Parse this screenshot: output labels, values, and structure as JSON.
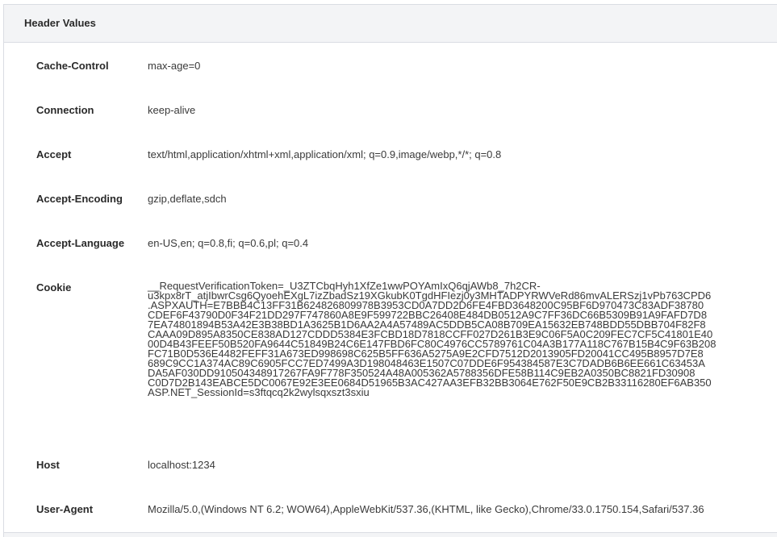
{
  "panel": {
    "title": "Header Values"
  },
  "headers": [
    {
      "name": "Cache-Control",
      "value": "max-age=0"
    },
    {
      "name": "Connection",
      "value": "keep-alive"
    },
    {
      "name": "Accept",
      "value": "text/html,application/xhtml+xml,application/xml; q=0.9,image/webp,*/*; q=0.8"
    },
    {
      "name": "Accept-Encoding",
      "value": "gzip,deflate,sdch"
    },
    {
      "name": "Accept-Language",
      "value": "en-US,en; q=0.8,fi; q=0.6,pl; q=0.4"
    },
    {
      "name": "Cookie",
      "lines": [
        "__RequestVerificationToken=_U3ZTCbqHyh1XfZe1wwPOYAmIxQ6qjAWb8_7h2CR-",
        "u3kpx8rT_atjIbwrCsg6QyoehEXgL7izZbadSz19XGkubK0TgdHFIezj0y3MHTADPYRWVeRd86mvALERSzj1vPb763CPD6",
        ".ASPXAUTH=E7BBB4C13FF31B624826809978B3953CD0A7DD2D6FE4FBD3648200C95BF6D970473C83ADF38780",
        "CDEF6F43790D0F34F21DD297F747860A8E9F599722BBC26408E484DB0512A9C7FF36DC66B5309B91A9FAFD7D8",
        "7EA74801894B53A42E3B38BD1A3625B1D6AA2A4A57489AC5DDB5CA08B709EA15632EB748BDD55DBB704F82F8",
        "CAAA09D895A8350CE838AD127CDDD5384E3FCBD18D7818CCFF027D261B3E9C06F5A0C209FEC7CF5C41801E40",
        "00D4B43FEEF50B520FA9644C51849B24C6E147FBD6FC80C4976CC5789761C04A3B177A118C767B15B4C9F63B208",
        "FC71B0D536E4482FEFF31A673ED998698C625B5FF636A5275A9E2CFD7512D2013905FD20041CC495B8957D7E8",
        "689C9CC1A374AC89C6905FCC7ED7499A3D198048463E1507C07DDE6F954384587E3C7DADB6B6EE661C63453A",
        "DA5AF030DD910504348917267FA9F778F350524A48A005362A5788356DFE58B114C9EB2A0350BC8821FD30908",
        "C0D7D2B143EABCE5DC0067E92E3EE0684D51965B3AC427AA3EFB32BB3064E762F50E9CB2B33116280EF6AB350",
        "ASP.NET_SessionId=s3ftqcq2k2wylsqxszt3sxiu"
      ]
    },
    {
      "name": "Host",
      "value": "localhost:1234"
    },
    {
      "name": "User-Agent",
      "value": "Mozilla/5.0,(Windows NT 6.2; WOW64),AppleWebKit/537.36,(KHTML, like Gecko),Chrome/33.0.1750.154,Safari/537.36"
    }
  ]
}
